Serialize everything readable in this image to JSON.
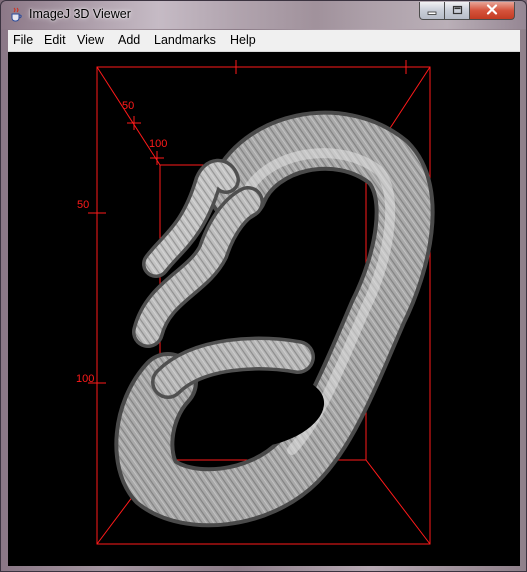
{
  "window": {
    "title": "ImageJ 3D Viewer",
    "icons": {
      "app": "java-cup-icon",
      "minimize": "minimize-icon",
      "maximize": "maximize-icon",
      "close": "close-icon"
    }
  },
  "menu": {
    "items": [
      {
        "label": "File"
      },
      {
        "label": "Edit"
      },
      {
        "label": "View"
      },
      {
        "label": "Add"
      },
      {
        "label": "Landmarks"
      },
      {
        "label": "Help"
      }
    ]
  },
  "viewer": {
    "background": "#000000",
    "box_color": "#ff1a1a",
    "surface_color": "#b9b9b9",
    "axis_labels": {
      "diag_50": "50",
      "diag_100": "100",
      "vert_50": "50",
      "vert_100": "100"
    }
  }
}
